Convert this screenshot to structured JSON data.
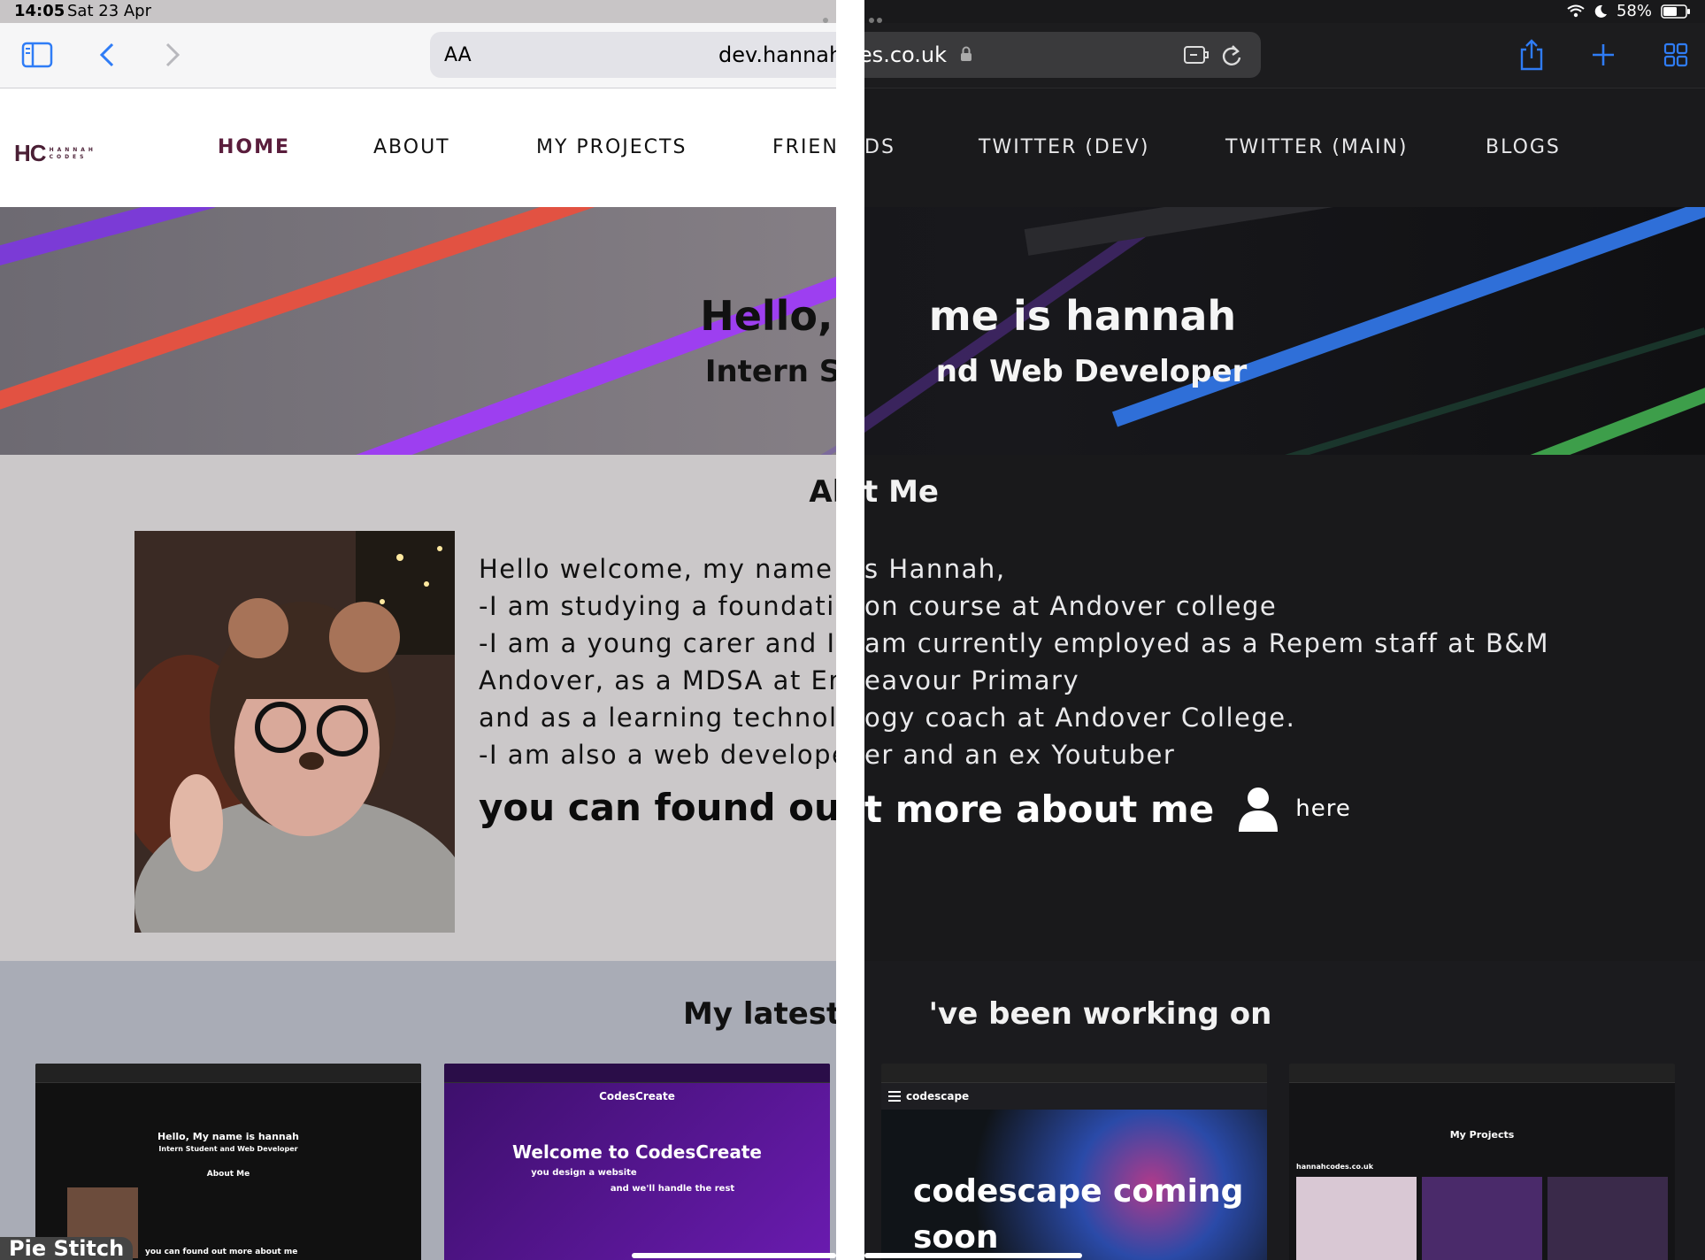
{
  "status": {
    "time": "14:05",
    "date": "Sat 23 Apr",
    "battery": "58%"
  },
  "browser": {
    "aa_label": "AA",
    "url_left": "dev.hannahc",
    "url_right": "odes.co.uk"
  },
  "nav": {
    "logo_hc": "HC",
    "logo_line1": "HANNAH",
    "logo_line2": "CODES",
    "items_left": [
      "HOME",
      "ABOUT",
      "MY PROJECTS",
      "FRIEND"
    ],
    "items_right": [
      "DS",
      "TWITTER (DEV)",
      "TWITTER (MAIN)",
      "BLOGS"
    ]
  },
  "hero": {
    "title_left": "Hello, My nar",
    "title_right": "me is hannah",
    "subtitle_left": "Intern Student ar",
    "subtitle_right": "nd Web Developer"
  },
  "about": {
    "heading_left": "Abou",
    "heading_right": "t Me",
    "lines_left": [
      "Hello welcome, my name is",
      "-I am studying a foundatio",
      "-I am a young carer and I",
      "Andover, as a MDSA at End",
      "and as a learning technolo",
      "-I am also a web develope"
    ],
    "lines_right": [
      "s Hannah,",
      "on course at Andover college",
      "am currently employed as a Repem staff at B&M",
      "eavour Primary",
      "ogy coach at Andover College.",
      "er and an ex Youtuber"
    ],
    "more_left": "you can found out",
    "more_right": "t more about me",
    "more_link": "here"
  },
  "projects": {
    "heading_left": "My latest Projects, i",
    "heading_right": "'ve been working on",
    "cards": [
      {
        "title": "Hello, My name is hannah",
        "subtitle": "Intern Student and Web Developer",
        "section": "About Me",
        "footer": "you can found out more about me"
      },
      {
        "title": "Welcome to CodesCreate",
        "brand": "CodesCreate",
        "line1": "you design a website",
        "line2": "and we'll handle the rest"
      },
      {
        "brand": "codescape",
        "title": "codescape coming",
        "title2": "soon"
      },
      {
        "title": "My Projects",
        "site": "hannahcodes.co.uk"
      }
    ]
  },
  "pip_label": "Pie Stitch",
  "colors": {
    "brand": "#5a1d3c",
    "left_bg": "#cbc8c9",
    "right_bg": "#19191b",
    "accent_blue": "#2f7cf6"
  }
}
